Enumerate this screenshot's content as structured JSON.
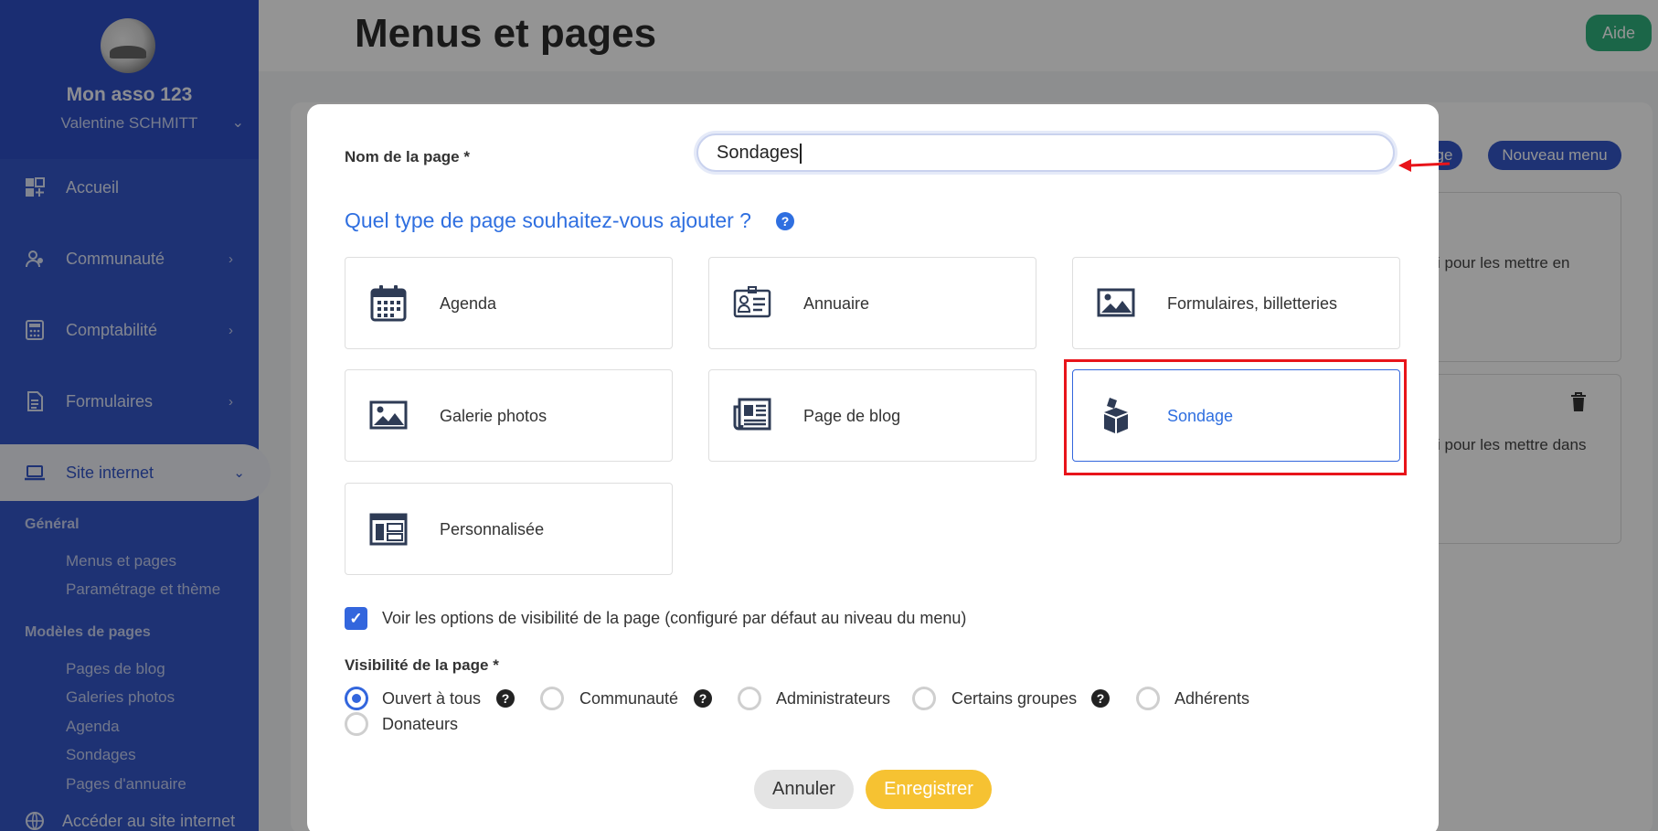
{
  "sidebar": {
    "org_name": "Mon asso 123",
    "user_name": "Valentine SCHMITT",
    "nav": [
      {
        "label": "Accueil"
      },
      {
        "label": "Communauté"
      },
      {
        "label": "Comptabilité"
      },
      {
        "label": "Formulaires"
      },
      {
        "label": "Site internet"
      }
    ],
    "section_general": "Général",
    "general_items": [
      "Menus et pages",
      "Paramétrage et thème"
    ],
    "section_models": "Modèles de pages",
    "model_items": [
      "Pages de blog",
      "Galeries photos",
      "Agenda",
      "Sondages",
      "Pages d'annuaire"
    ],
    "bottom_link": "Accéder au site internet"
  },
  "header": {
    "title": "Menus et pages",
    "help_label": "Aide"
  },
  "background": {
    "new_page_partial": "ge",
    "new_menu": "Nouveau menu",
    "text_1": "i pour les mettre en",
    "text_2": "i pour les mettre dans"
  },
  "modal": {
    "name_label": "Nom de la page *",
    "name_value": "Sondages",
    "question": "Quel type de page souhaitez-vous ajouter ?",
    "help_glyph": "?",
    "types": [
      {
        "label": "Agenda",
        "icon": "calendar-icon"
      },
      {
        "label": "Annuaire",
        "icon": "directory-icon"
      },
      {
        "label": "Formulaires, billetteries",
        "icon": "image-icon"
      },
      {
        "label": "Galerie photos",
        "icon": "image-icon"
      },
      {
        "label": "Page de blog",
        "icon": "newspaper-icon"
      },
      {
        "label": "Sondage",
        "icon": "ballot-box-icon",
        "selected": true
      },
      {
        "label": "Personnalisée",
        "icon": "layout-icon"
      }
    ],
    "visibility_options_checkbox": {
      "checked": true,
      "label": "Voir les options de visibilité de la page (configuré par défaut au niveau du menu)"
    },
    "visibility_label": "Visibilité de la page *",
    "visibility": {
      "selected": "Ouvert à tous",
      "options": [
        "Ouvert à tous",
        "Communauté",
        "Administrateurs",
        "Certains groupes",
        "Adhérents",
        "Donateurs"
      ]
    },
    "cancel_label": "Annuler",
    "save_label": "Enregistrer"
  },
  "colors": {
    "sidebar": "#3457c9",
    "accent_blue": "#2f6fe0",
    "save": "#f6c232",
    "help": "#2fb07d",
    "highlight": "#e8141a"
  }
}
